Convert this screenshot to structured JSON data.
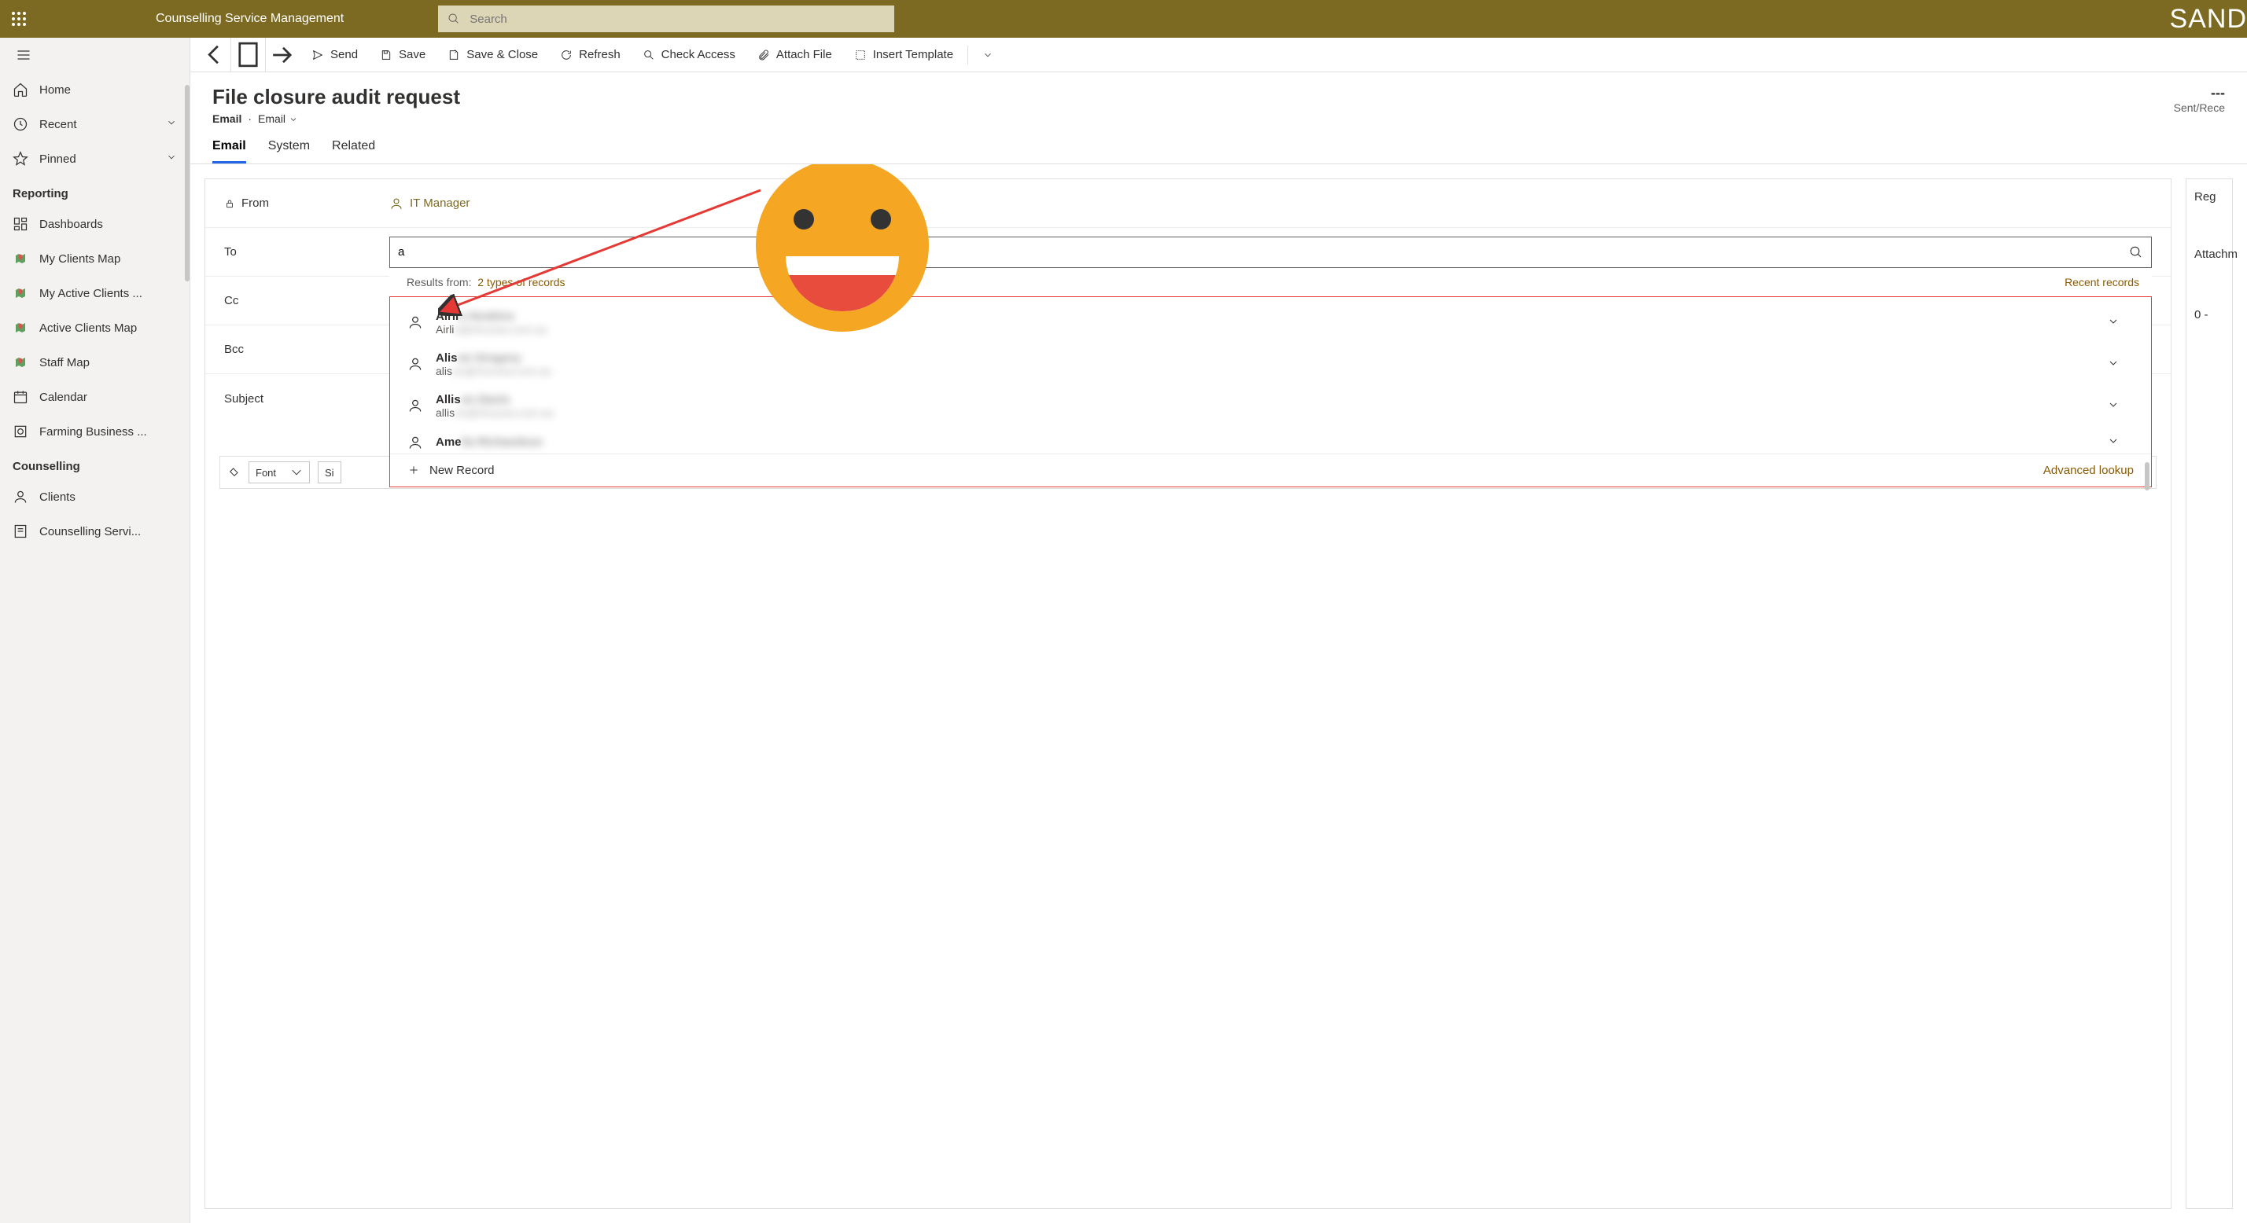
{
  "app": {
    "title": "Counselling Service Management",
    "search_placeholder": "Search",
    "env_label": "SAND"
  },
  "sidebar": {
    "items": [
      {
        "label": "Home"
      },
      {
        "label": "Recent"
      },
      {
        "label": "Pinned"
      }
    ],
    "group_reporting": "Reporting",
    "reporting_items": [
      {
        "label": "Dashboards"
      },
      {
        "label": "My Clients Map"
      },
      {
        "label": "My Active Clients ..."
      },
      {
        "label": "Active Clients Map"
      },
      {
        "label": "Staff Map"
      },
      {
        "label": "Calendar"
      },
      {
        "label": "Farming Business ..."
      }
    ],
    "group_counselling": "Counselling",
    "counselling_items": [
      {
        "label": "Clients"
      },
      {
        "label": "Counselling Servi..."
      }
    ]
  },
  "cmdbar": {
    "send": "Send",
    "save": "Save",
    "save_close": "Save & Close",
    "refresh": "Refresh",
    "check_access": "Check Access",
    "attach_file": "Attach File",
    "insert_template": "Insert Template"
  },
  "record": {
    "title": "File closure audit request",
    "entity": "Email",
    "form_name": "Email",
    "status_dashes": "---",
    "status_label": "Sent/Rece"
  },
  "tabs": [
    {
      "label": "Email",
      "active": true
    },
    {
      "label": "System"
    },
    {
      "label": "Related"
    }
  ],
  "form": {
    "from_label": "From",
    "from_value": "IT Manager",
    "to_label": "To",
    "to_value": "a",
    "cc_label": "Cc",
    "bcc_label": "Bcc",
    "subject_label": "Subject"
  },
  "lookup": {
    "results_from": "Results from:",
    "record_types": "2 types of records",
    "recent_records": "Recent records",
    "items": [
      {
        "prefix": "Airli",
        "name_rest": "e Hoskins",
        "eprefix": "Airli",
        "email_rest": "e@rfcsnsw.com.au"
      },
      {
        "prefix": "Alis",
        "name_rest": "on Gregory",
        "eprefix": "alis",
        "email_rest": "on@rfcsnsw.com.au"
      },
      {
        "prefix": "Allis",
        "name_rest": "on Davis",
        "eprefix": "allis",
        "email_rest": "on@rfcsnsw.com.au"
      },
      {
        "prefix": "Ame",
        "name_rest": "lia Richardson",
        "eprefix": "",
        "email_rest": ""
      }
    ],
    "new_record": "New Record",
    "advanced_lookup": "Advanced lookup"
  },
  "side": {
    "regarding": "Reg",
    "attachments": "Attachm",
    "attachments_count": "0 -"
  },
  "editor": {
    "font_label": "Font",
    "size_prefix": "Si"
  }
}
